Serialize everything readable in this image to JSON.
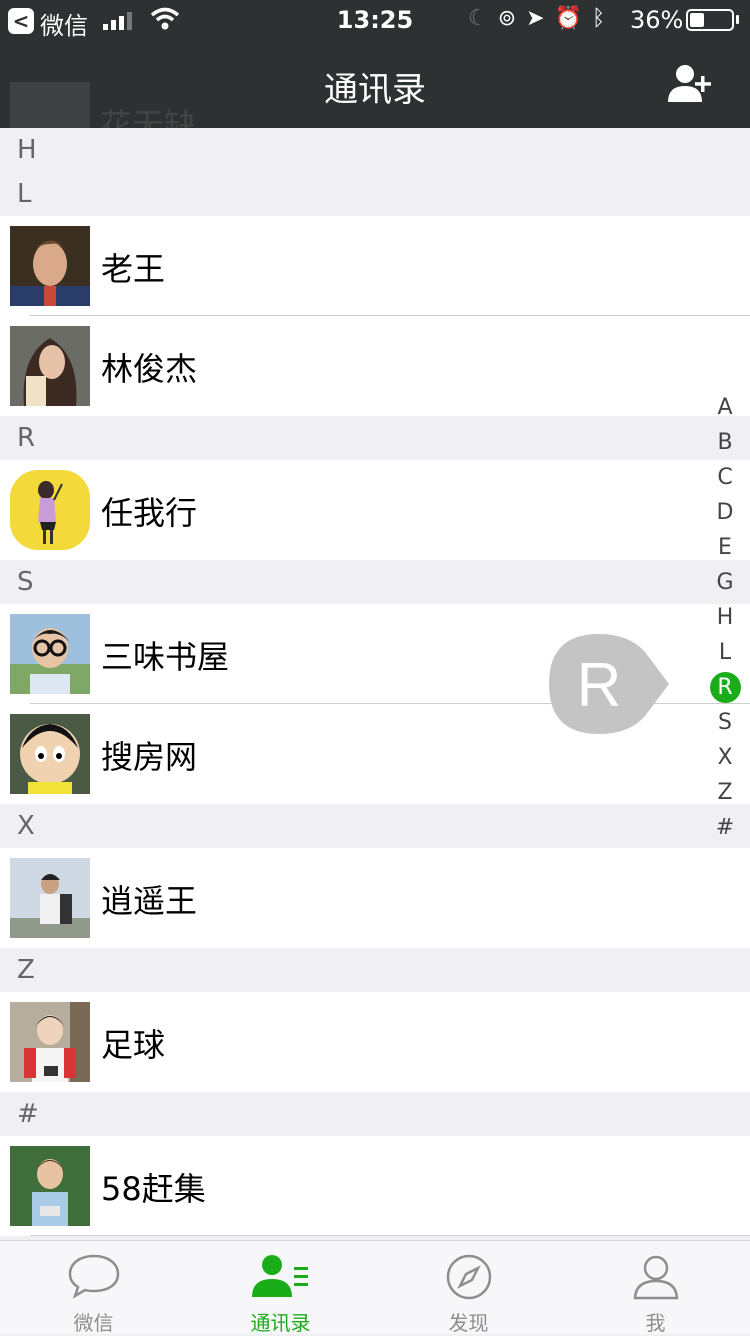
{
  "status_bar": {
    "carrier": "微信",
    "time": "13:25",
    "battery": "36%",
    "battery_level": 0.36
  },
  "header": {
    "title": "通讯录",
    "scrolled_name": "花无缺"
  },
  "sections": [
    {
      "letter": "H",
      "contacts": []
    },
    {
      "letter": "L",
      "contacts": [
        {
          "name": "老王"
        },
        {
          "name": "林俊杰"
        }
      ]
    },
    {
      "letter": "R",
      "contacts": [
        {
          "name": "任我行"
        }
      ]
    },
    {
      "letter": "S",
      "contacts": [
        {
          "name": "三味书屋"
        },
        {
          "name": "搜房网"
        }
      ]
    },
    {
      "letter": "X",
      "contacts": [
        {
          "name": "逍遥王"
        }
      ]
    },
    {
      "letter": "Z",
      "contacts": [
        {
          "name": "足球"
        }
      ]
    },
    {
      "letter": "#",
      "contacts": [
        {
          "name": "58赶集"
        }
      ]
    }
  ],
  "index_bar": {
    "letters": [
      "A",
      "B",
      "C",
      "D",
      "E",
      "G",
      "H",
      "L",
      "R",
      "S",
      "X",
      "Z",
      "#"
    ],
    "active": "R"
  },
  "index_bubble": "R",
  "tabs": [
    {
      "label": "微信",
      "icon": "chat-bubble-icon",
      "active": false
    },
    {
      "label": "通讯录",
      "icon": "contacts-icon",
      "active": true
    },
    {
      "label": "发现",
      "icon": "compass-icon",
      "active": false
    },
    {
      "label": "我",
      "icon": "person-icon",
      "active": false
    }
  ],
  "colors": {
    "accent": "#1aad19",
    "navbar": "#2e3132",
    "section_bg": "#efeff4"
  }
}
